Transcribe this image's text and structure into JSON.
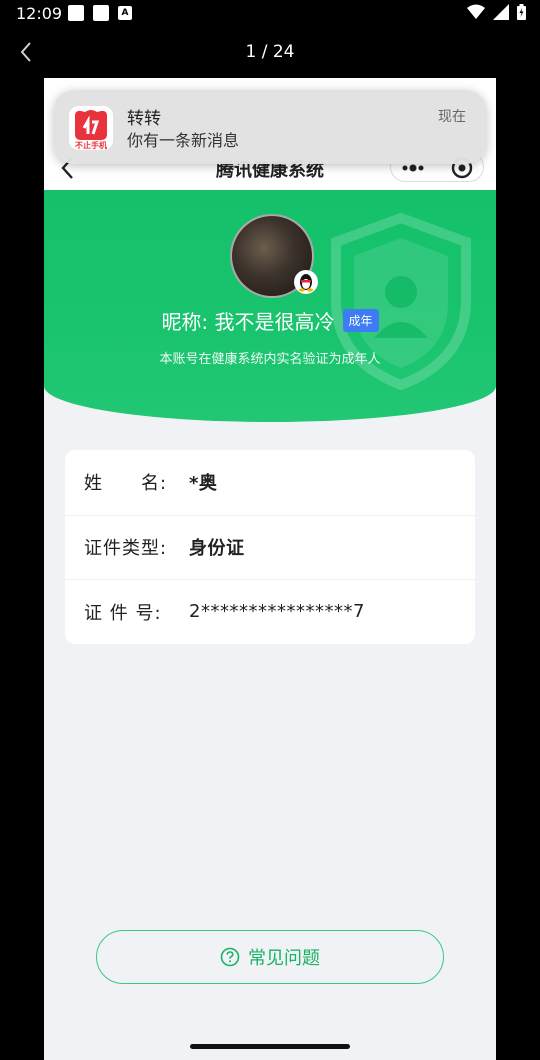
{
  "status_bar": {
    "time": "12:09"
  },
  "viewer": {
    "counter": "1 / 24"
  },
  "notification": {
    "app_name": "转转",
    "message": "你有一条新消息",
    "time": "现在",
    "icon_caption": "不止手机"
  },
  "app": {
    "title": "腾讯健康系统",
    "nickname": "昵称: 我不是很高冷",
    "age_badge": "成年",
    "verify_note": "本账号在健康系统内实名验证为成年人",
    "fields": [
      {
        "label": "姓　　名:",
        "value": "*奥"
      },
      {
        "label": "证件类型:",
        "value": "身份证"
      },
      {
        "label": "证 件 号:",
        "value": "2****************7"
      }
    ],
    "faq_label": "常见问题"
  },
  "colors": {
    "brand_green": "#14c06a",
    "badge_blue": "#3d7cf5",
    "notif_red": "#e8323c"
  },
  "icons": [
    "back-arrow-icon",
    "qq-penguin-icon",
    "shield-icon",
    "question-circle-icon",
    "wifi-icon",
    "signal-icon",
    "battery-icon"
  ]
}
